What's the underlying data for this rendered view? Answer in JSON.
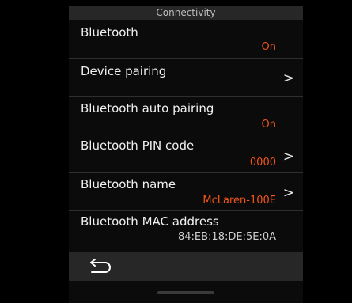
{
  "header": {
    "title": "Connectivity"
  },
  "rows": [
    {
      "label": "Bluetooth",
      "value": "On"
    },
    {
      "label": "Device pairing",
      "chevron": ">"
    },
    {
      "label": "Bluetooth auto pairing",
      "value": "On"
    },
    {
      "label": "Bluetooth PIN code",
      "value": "0000",
      "chevron": ">"
    },
    {
      "label": "Bluetooth name",
      "value": "McLaren-100E",
      "chevron": ">"
    },
    {
      "label": "Bluetooth MAC address",
      "value": "84:EB:18:DE:5E:0A"
    }
  ],
  "footer": {
    "back_icon": "back-arrow-icon"
  },
  "colors": {
    "background": "#000000",
    "panel": "#0b0b0b",
    "bar": "#272727",
    "accent": "#f2541b",
    "text": "#f0f0f0"
  }
}
